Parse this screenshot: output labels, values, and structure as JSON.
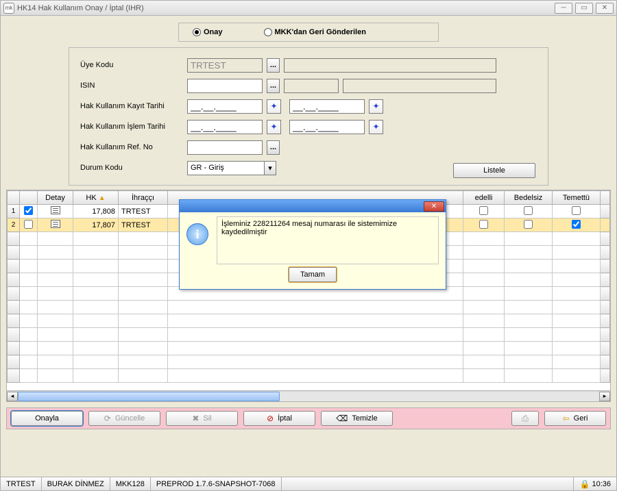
{
  "window": {
    "title": "HK14 Hak Kullanım Onay / İptal (IHR)"
  },
  "toggle": {
    "onay": "Onay",
    "mkk": "MKK'dan Geri Gönderilen",
    "selected": "onay"
  },
  "form": {
    "uye_kodu_label": "Üye Kodu",
    "uye_kodu_value": "TRTEST",
    "isin_label": "ISIN",
    "kayit_tarihi_label": "Hak Kullanım Kayıt Tarihi",
    "islem_tarihi_label": "Hak Kullanım İşlem Tarihi",
    "ref_no_label": "Hak Kullanım Ref. No",
    "durum_kodu_label": "Durum Kodu",
    "durum_kodu_value": "GR - Giriş",
    "date_mask": "__.__.____",
    "listele": "Listele"
  },
  "grid": {
    "headers": {
      "detay": "Detay",
      "hk": "HK",
      "ihracci": "İhraççı",
      "bedelli": "edelli",
      "bedelsiz": "Bedelsiz",
      "temettu": "Temettü"
    },
    "rows": [
      {
        "idx": "1",
        "sel": true,
        "hk": "17,808",
        "ihracci": "TRTEST",
        "bedelli": false,
        "bedelsiz": false,
        "temettu": false
      },
      {
        "idx": "2",
        "sel": false,
        "hk": "17,807",
        "ihracci": "TRTEST",
        "bedelli": false,
        "bedelsiz": false,
        "temettu": true
      }
    ]
  },
  "actions": {
    "onayla": "Onayla",
    "guncelle": "Güncelle",
    "sil": "Sil",
    "iptal": "İptal",
    "temizle": "Temizle",
    "geri": "Geri"
  },
  "status": {
    "uye": "TRTEST",
    "user": "BURAK DİNMEZ",
    "terminal": "MKK128",
    "env": "PREPROD 1.7.6-SNAPSHOT-7068",
    "time": "10:36"
  },
  "dialog": {
    "message": "İşleminiz 228211264 mesaj numarası ile sistemimize kaydedilmiştir",
    "ok": "Tamam"
  }
}
